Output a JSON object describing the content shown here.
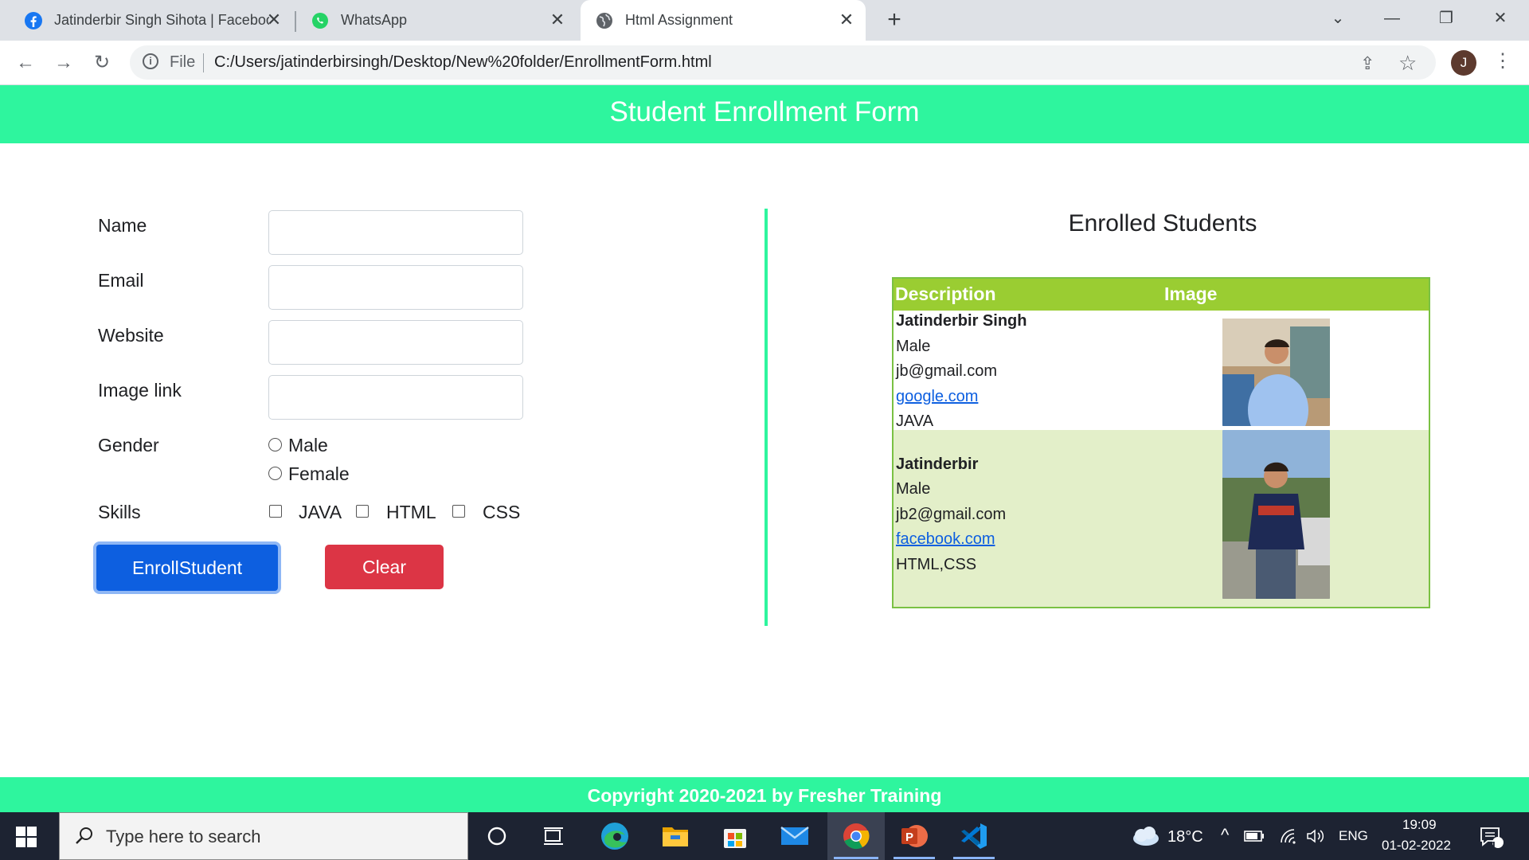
{
  "browser": {
    "tabs": [
      {
        "title": "Jatinderbir Singh Sihota | Facebook",
        "icon": "facebook-icon"
      },
      {
        "title": "WhatsApp",
        "icon": "whatsapp-icon"
      },
      {
        "title": "Html Assignment",
        "icon": "globe-icon",
        "active": true
      }
    ],
    "address": {
      "scheme_label": "File",
      "url": "C:/Users/jatinderbirsingh/Desktop/New%20folder/EnrollmentForm.html"
    },
    "profile_initial": "J"
  },
  "page": {
    "header_title": "Student Enrollment Form",
    "form": {
      "name_label": "Name",
      "email_label": "Email",
      "website_label": "Website",
      "image_label": "Image link",
      "gender_label": "Gender",
      "gender_options": [
        "Male",
        "Female"
      ],
      "skills_label": "Skills",
      "skills_options": [
        "JAVA",
        "HTML",
        "CSS"
      ],
      "enroll_button": "EnrollStudent",
      "clear_button": "Clear",
      "name_value": "",
      "email_value": "",
      "website_value": "",
      "image_value": ""
    },
    "enrolled": {
      "title": "Enrolled Students",
      "columns": [
        "Description",
        "Image"
      ],
      "students": [
        {
          "name": "Jatinderbir Singh",
          "gender": "Male",
          "email": "jb@gmail.com",
          "website": "google.com",
          "skills": "JAVA"
        },
        {
          "name": "Jatinderbir",
          "gender": "Male",
          "email": "jb2@gmail.com",
          "website": "facebook.com",
          "skills": "HTML,CSS"
        }
      ]
    },
    "footer": "Copyright 2020-2021 by Fresher Training"
  },
  "taskbar": {
    "search_placeholder": "Type here to search",
    "weather": "18°C",
    "language": "ENG",
    "time": "19:09",
    "date": "01-02-2022",
    "notification_count": "1"
  },
  "colors": {
    "accent": "#2ef59e",
    "table_header": "#9acd32",
    "enroll_button": "#0d5fe0",
    "clear_button": "#dc3545"
  }
}
